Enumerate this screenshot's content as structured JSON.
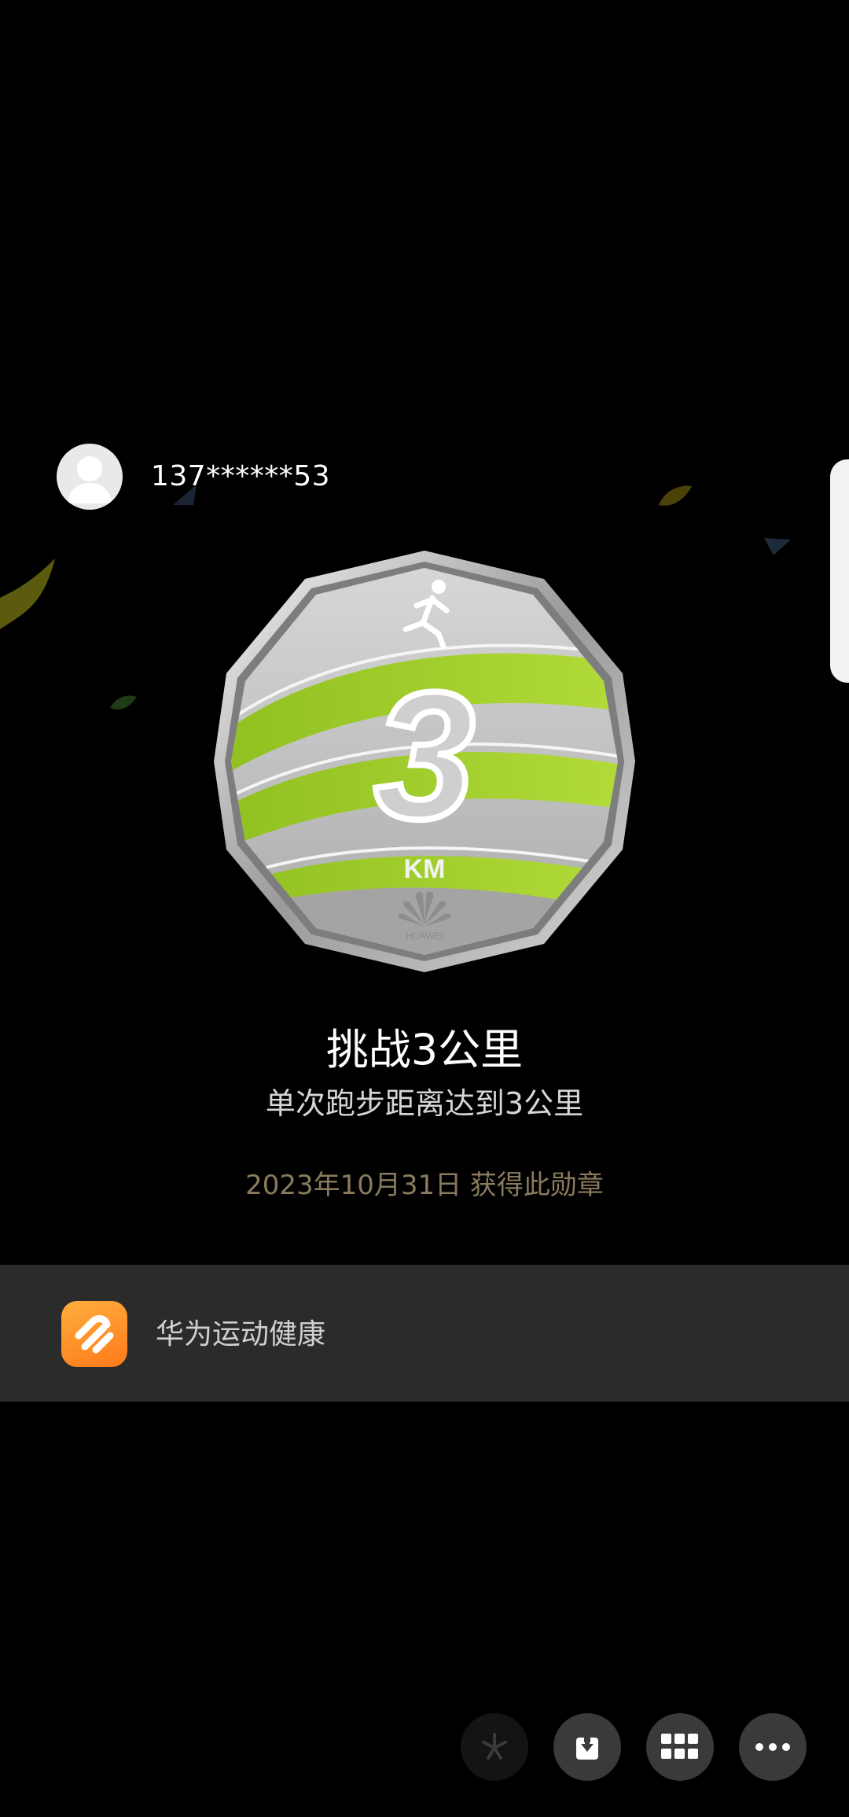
{
  "user": {
    "phone_masked": "137******53",
    "avatar_icon": "avatar-placeholder-icon"
  },
  "medal": {
    "distance_number": "3",
    "unit": "KM",
    "brand": "HUAWEI",
    "accent_color": "#9ccc2c",
    "runner_icon": "runner-icon"
  },
  "badge": {
    "title": "挑战3公里",
    "description": "单次跑步距离达到3公里",
    "earned_text": "2023年10月31日 获得此勋章"
  },
  "app": {
    "name": "华为运动健康",
    "icon": "huawei-health-app-icon",
    "icon_color": "#ff8c26"
  },
  "actions": {
    "share_icon": "share-sparkle-icon",
    "save_icon": "download-icon",
    "apps_icon": "grid-icon",
    "more_icon": "more-dots-icon"
  }
}
